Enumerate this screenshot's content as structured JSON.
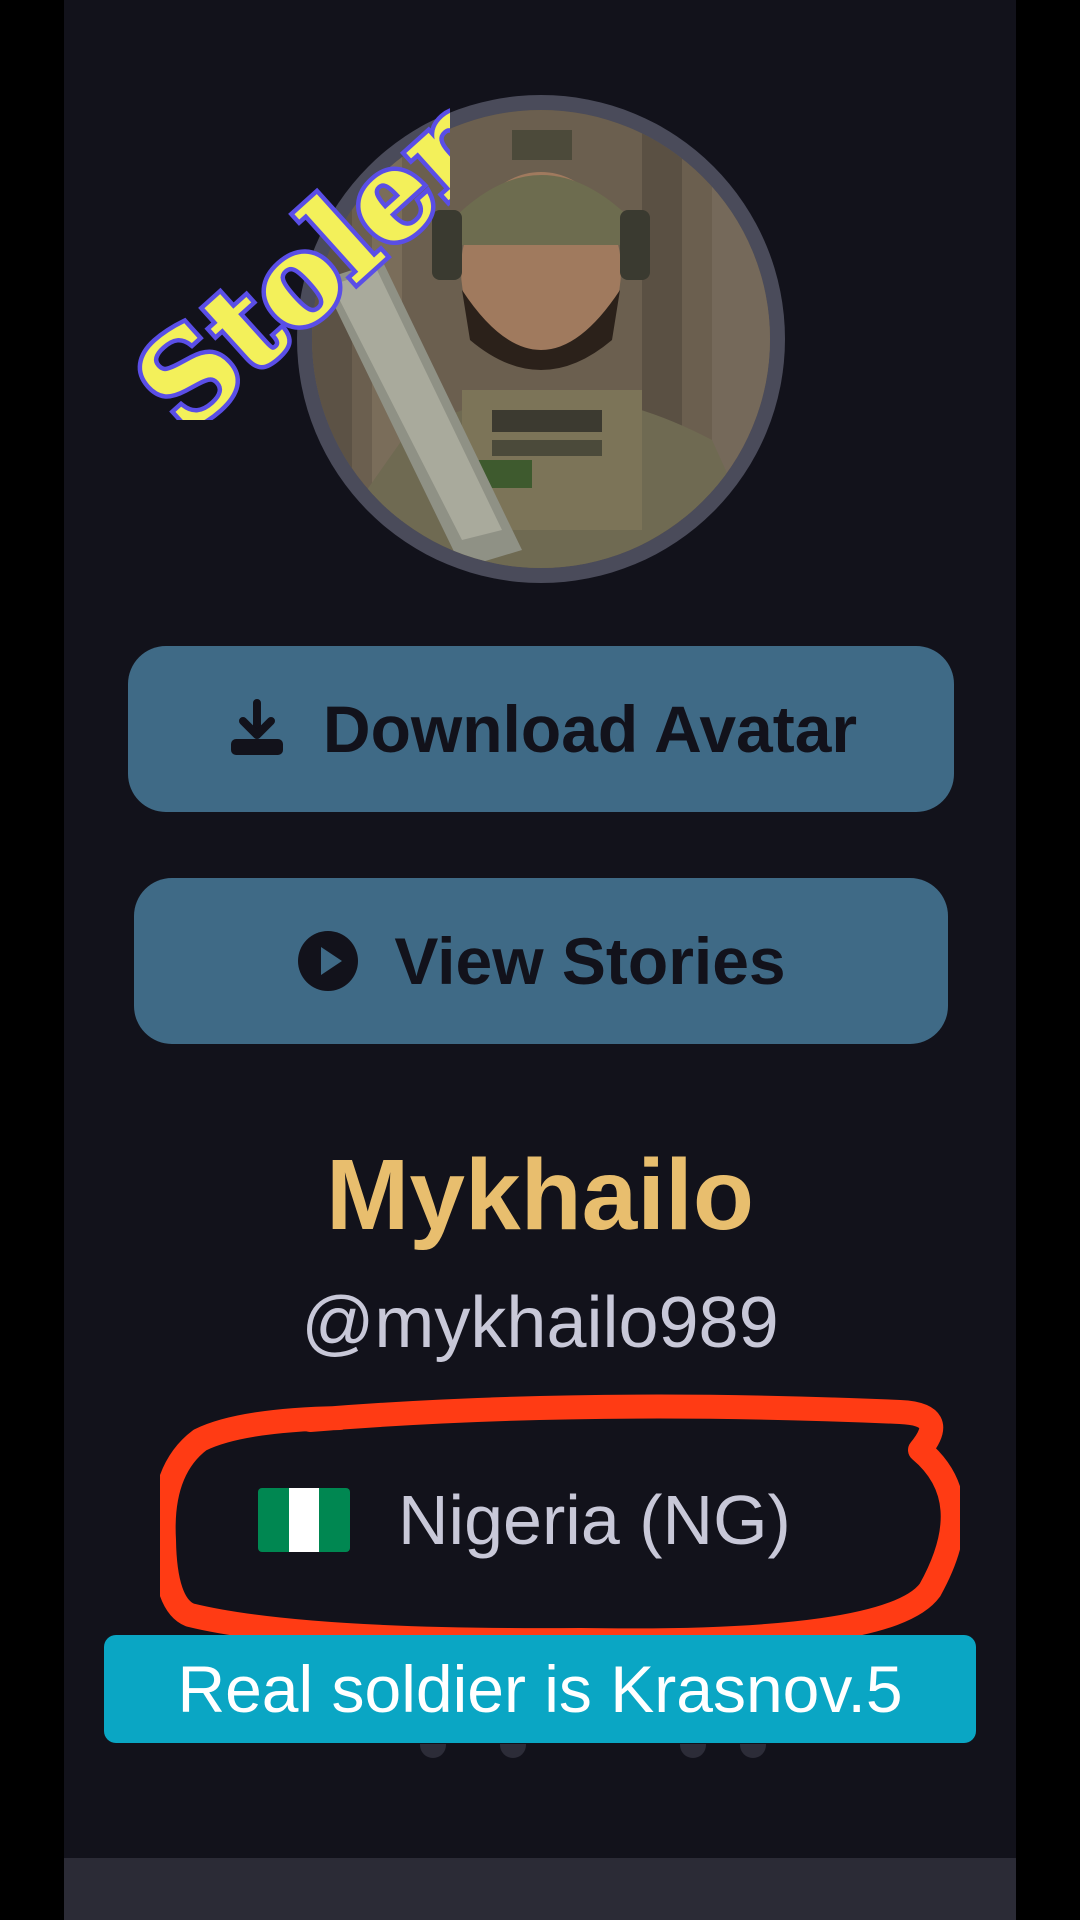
{
  "profile": {
    "name": "Mykhailo",
    "handle": "@mykhailo989",
    "country": "Nigeria (NG)",
    "flag_colors": [
      "#008751",
      "#ffffff",
      "#008751"
    ]
  },
  "buttons": {
    "download_avatar": {
      "label": "Download Avatar",
      "icon": "download-icon"
    },
    "view_stories": {
      "label": "View Stories",
      "icon": "play-circle-icon"
    }
  },
  "overlays": {
    "stamp_text": "Stolen",
    "caption": "Real soldier is Krasnov.5"
  },
  "colors": {
    "panel_bg": "#12121b",
    "button_bg": "#3f6a86",
    "name_color": "#e8be6e",
    "handle_color": "#c8c8d8",
    "annotation_red": "#ff3b14",
    "caption_bg": "#0aa6c4",
    "stamp_fill": "#f3f05a",
    "stamp_outline": "#5a4ee6"
  }
}
